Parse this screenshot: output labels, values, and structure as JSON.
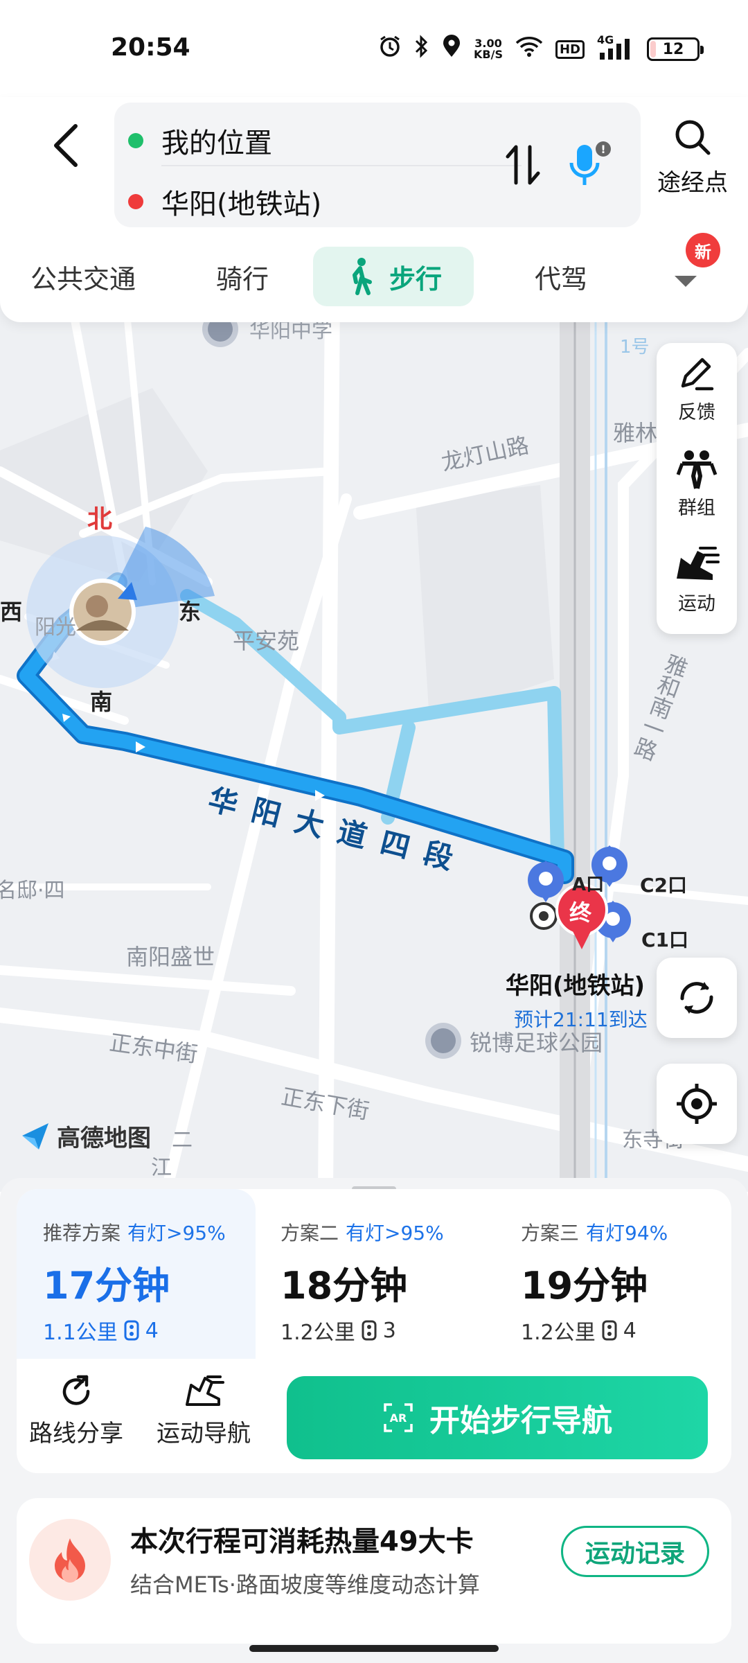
{
  "status_bar": {
    "time": "20:54",
    "net_speed_value": "3.00",
    "net_speed_unit": "KB/S",
    "hd_label": "HD",
    "signal_label": "4G",
    "battery_level": "12",
    "icons": [
      "alarm-icon",
      "bluetooth-icon",
      "location-icon",
      "wifi-icon",
      "signal-icon",
      "battery-icon"
    ]
  },
  "search": {
    "origin": "我的位置",
    "destination": "华阳(地铁站)",
    "waypoint_label": "途经点",
    "origin_color": "#1fbf6b",
    "destination_color": "#ef3b3b"
  },
  "modes": {
    "tabs": [
      {
        "label": "公共交通"
      },
      {
        "label": "骑行"
      },
      {
        "label": "步行"
      },
      {
        "label": "代驾"
      }
    ],
    "active": "步行",
    "new_badge": "新"
  },
  "map": {
    "labels": {
      "school": "华阳中学",
      "longdeng": "龙灯山路",
      "ya": "雅林",
      "yahe": "雅和南一路",
      "pingan": "平安苑",
      "huayang_road": "华阳大道四段",
      "nanyang": "南阳盛世",
      "zhengdong_mid": "正东中街",
      "zhengdong_down": "正东下街",
      "dongsi": "东寺街",
      "park": "锐博足球公园",
      "left_street": "名邸·四",
      "yangguang": "阳光",
      "jiang": "江",
      "er": "二",
      "metro_line": "1号",
      "compass_n": "北",
      "compass_s": "南",
      "compass_e": "东",
      "compass_w": "西",
      "exit_a": "A口",
      "exit_c2": "C2口",
      "exit_c1": "C1口",
      "dest_marker": "终",
      "dest_name": "华阳(地铁站)",
      "eta": "预计21:11到达"
    },
    "tools": [
      {
        "label": "反馈",
        "icon": "feedback-icon"
      },
      {
        "label": "群组",
        "icon": "group-icon"
      },
      {
        "label": "运动",
        "icon": "sport-shoe-icon"
      }
    ],
    "logo": "高德地图",
    "route_color": "#1a8fe0",
    "alt_route_color": "#8fd3f0"
  },
  "plans": [
    {
      "head": "推荐方案",
      "tag": "有灯>95%",
      "time": "17分钟",
      "distance": "1.1公里",
      "lights": "4"
    },
    {
      "head": "方案二",
      "tag": "有灯>95%",
      "time": "18分钟",
      "distance": "1.2公里",
      "lights": "3"
    },
    {
      "head": "方案三",
      "tag": "有灯94%",
      "time": "19分钟",
      "distance": "1.2公里",
      "lights": "4"
    }
  ],
  "actions": {
    "share": "路线分享",
    "sport_nav": "运动导航",
    "start": "开始步行导航"
  },
  "calories": {
    "title": "本次行程可消耗热量49大卡",
    "subtitle": "结合METs·路面坡度等维度动态计算",
    "record_button": "运动记录"
  }
}
